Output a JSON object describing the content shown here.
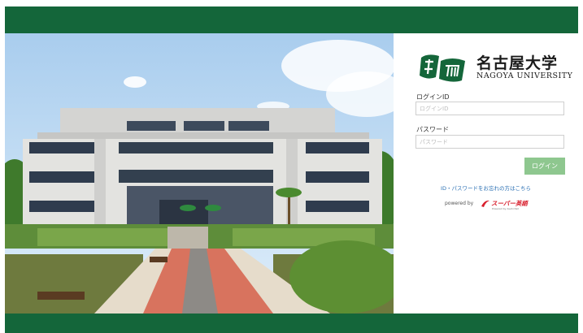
{
  "university": {
    "name_jp": "名古屋大学",
    "name_en": "NAGOYA UNIVERSITY"
  },
  "login": {
    "id_label": "ログインID",
    "id_placeholder": "ログインID",
    "password_label": "パスワード",
    "password_placeholder": "パスワード",
    "submit_label": "ログイン",
    "forgot_link": "ID・パスワードをお忘れの方はこちら"
  },
  "footer": {
    "powered_by": "powered by",
    "vendor_name": "スーパー英語",
    "vendor_sub": "Powered by Asahi Net"
  },
  "colors": {
    "brand_green": "#14663a",
    "button_green": "#8ec78f",
    "link_blue": "#2a6fb3"
  }
}
